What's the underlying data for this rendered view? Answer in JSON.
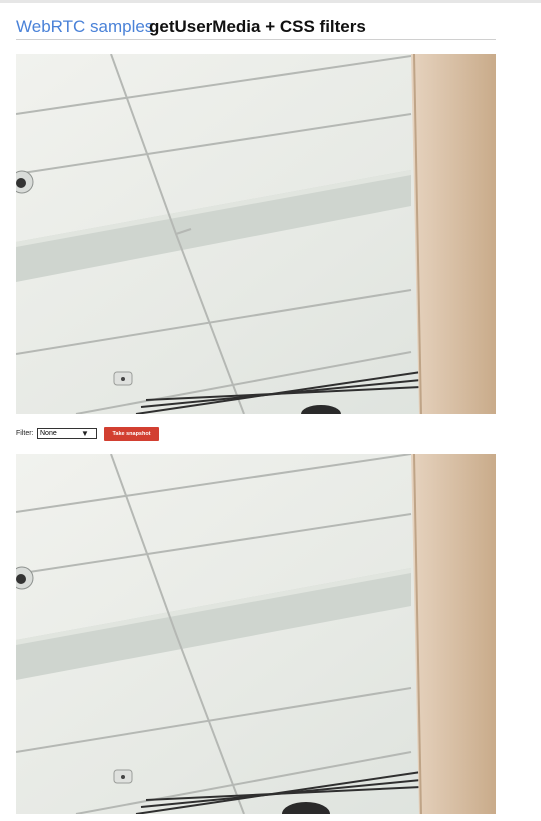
{
  "header": {
    "brand_link": "WebRTC samples",
    "title": "getUserMedia + CSS filters"
  },
  "controls": {
    "filter_label": "Filter:",
    "filter_selected": "None",
    "snapshot_button": "Take snapshot"
  },
  "colors": {
    "brand_link": "#4a82d8",
    "snapshot_button": "#d23f31",
    "ceiling": "#e9ece7",
    "wall": "#d8bea1"
  },
  "media": {
    "video_icon": "camera-feed-ceiling",
    "canvas_icon": "snapshot-ceiling"
  }
}
